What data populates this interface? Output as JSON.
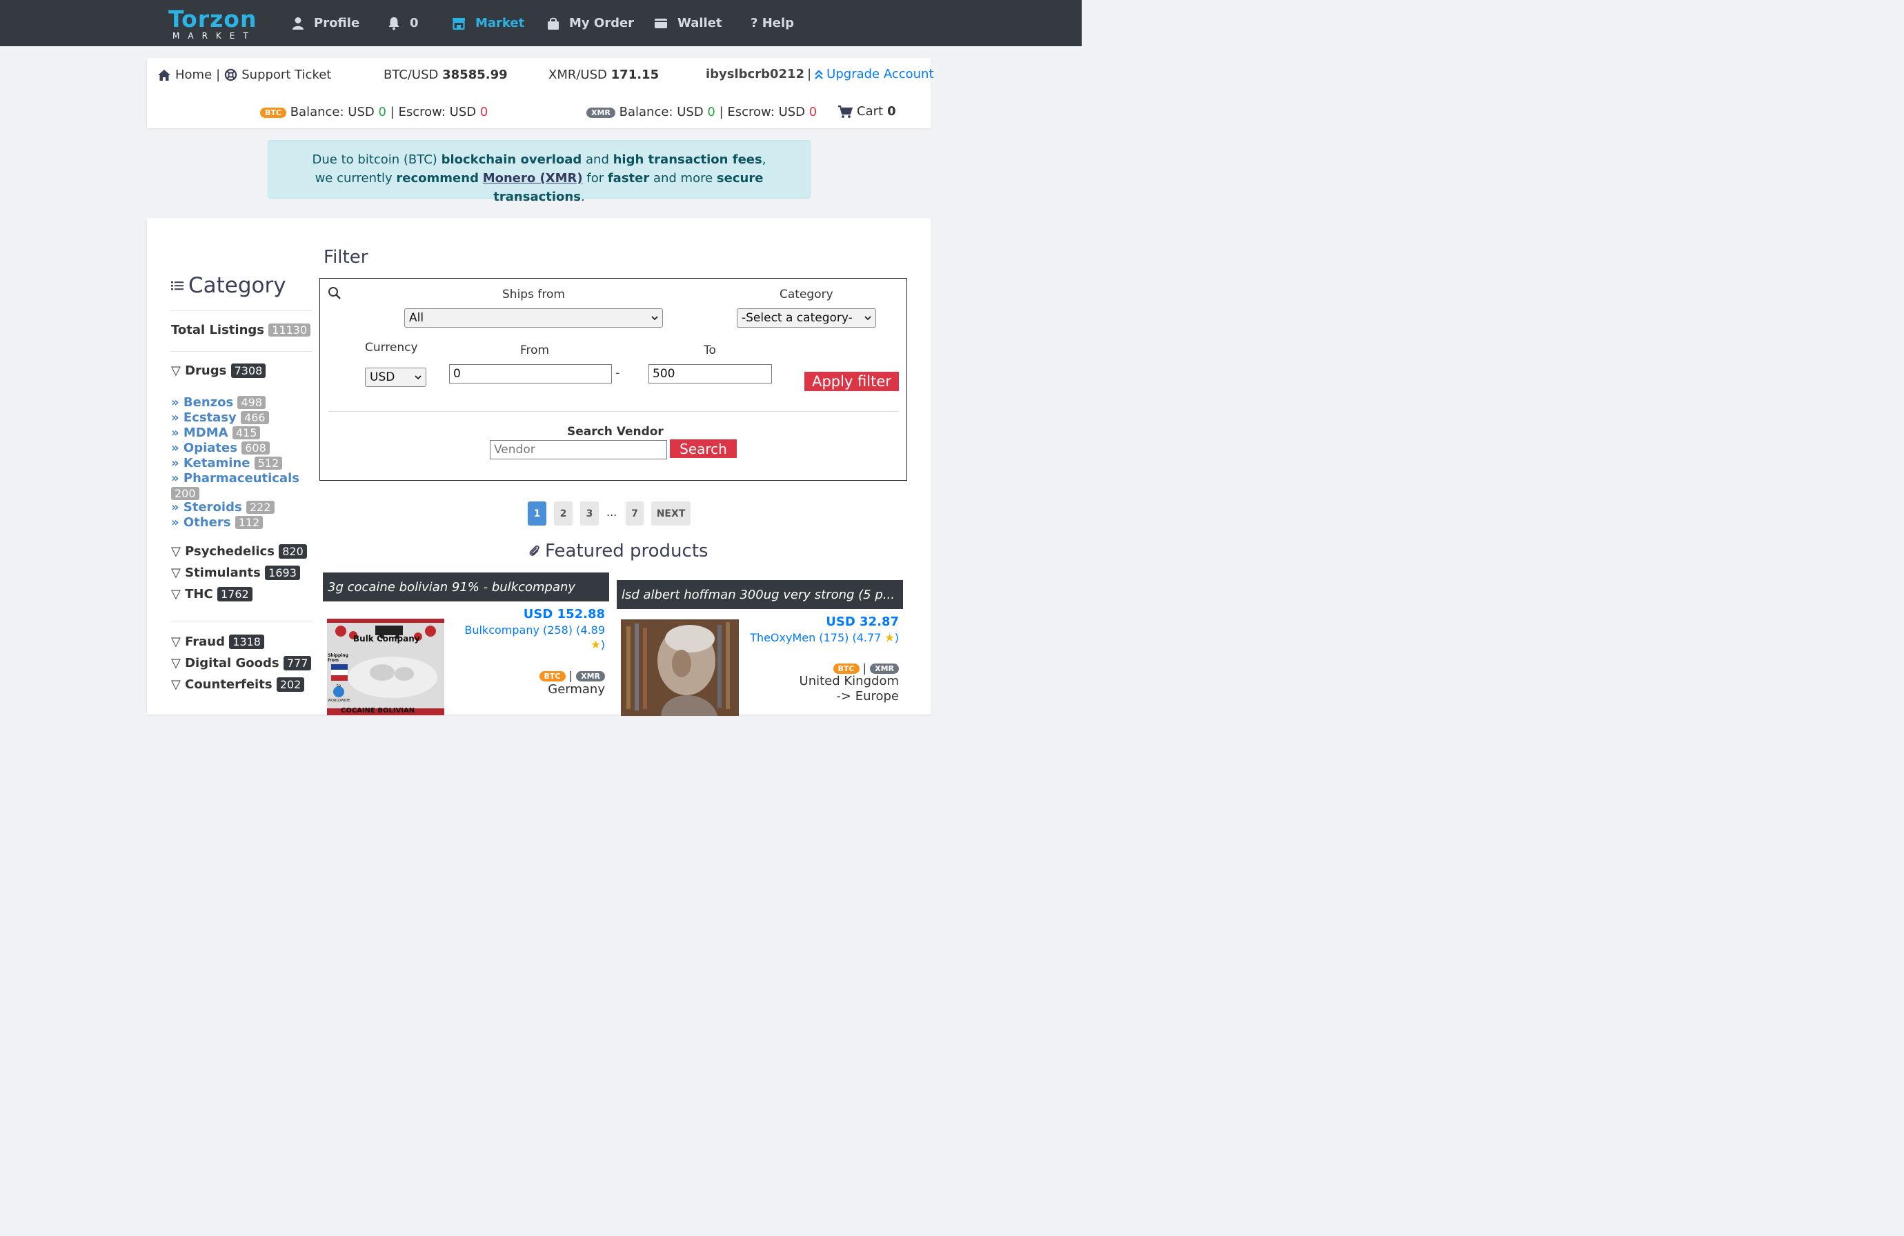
{
  "nav": {
    "logo": "Torzon",
    "logo_sub": "MARKET",
    "profile": "Profile",
    "notifications": "0",
    "market": "Market",
    "my_order": "My Order",
    "wallet": "Wallet",
    "help": "? Help"
  },
  "info": {
    "home": "Home",
    "sep1": "|",
    "support": "Support Ticket",
    "btc_label": "BTC/USD",
    "btc_value": "38585.99",
    "xmr_label": "XMR/USD",
    "xmr_value": "171.15",
    "username": "ibyslbcrb0212",
    "sep2": "|",
    "upgrade": "Upgrade Account",
    "btc_badge": "BTC",
    "xmr_badge": "XMR",
    "balance_label": "Balance: USD",
    "balance_value": "0",
    "escrow_label": "| Escrow: USD",
    "escrow_value": "0",
    "xmr_balance_value": "0",
    "xmr_escrow_value": "0",
    "cart_label": "Cart",
    "cart_count": "0"
  },
  "alert": {
    "l1_a": "Due to bitcoin (BTC)",
    "l1_b": "blockchain overload",
    "l1_c": "and",
    "l1_d": "high transaction fees",
    "l1_e": ",",
    "l2_a": "we currently",
    "l2_b": "recommend",
    "l2_c": "Monero (XMR)",
    "l2_d": "for",
    "l2_e": "faster",
    "l2_f": "and more",
    "l2_g": "secure transactions",
    "l2_h": "."
  },
  "sidebar": {
    "title": "Category",
    "total_label": "Total Listings",
    "total_count": "11130",
    "drugs_label": "▽ Drugs",
    "drugs_count": "7308",
    "subs": [
      {
        "label": "» Benzos",
        "count": "498"
      },
      {
        "label": "» Ecstasy",
        "count": "466"
      },
      {
        "label": "» MDMA",
        "count": "415"
      },
      {
        "label": "» Opiates",
        "count": "608"
      },
      {
        "label": "» Ketamine",
        "count": "512"
      },
      {
        "label": "» Pharmaceuticals",
        "count": "200"
      },
      {
        "label": "» Steroids",
        "count": "222"
      },
      {
        "label": "» Others",
        "count": "112"
      }
    ],
    "groups": [
      {
        "label": "▽ Psychedelics",
        "count": "820"
      },
      {
        "label": "▽ Stimulants",
        "count": "1693"
      },
      {
        "label": "▽ THC",
        "count": "1762"
      },
      {
        "label": "▽ Fraud",
        "count": "1318"
      },
      {
        "label": "▽ Digital Goods",
        "count": "777"
      },
      {
        "label": "▽ Counterfeits",
        "count": "202"
      }
    ]
  },
  "filter": {
    "title": "Filter",
    "ships_from_label": "Ships from",
    "ships_from_value": "All",
    "category_label": "Category",
    "category_value": "-Select a category-",
    "currency_label": "Currency",
    "currency_value": "USD",
    "from_label": "From",
    "from_value": "0",
    "range_sep": "-",
    "to_label": "To",
    "to_value": "500",
    "apply": "Apply filter",
    "vendor_label": "Search Vendor",
    "vendor_placeholder": "Vendor",
    "search": "Search"
  },
  "pagination": {
    "pages": [
      "1",
      "2",
      "3",
      "7"
    ],
    "ellipsis": "...",
    "next": "NEXT"
  },
  "featured": {
    "title": "Featured products",
    "products": [
      {
        "title": "3g cocaine bolivian 91% - bulkcompany",
        "price": "USD 152.88",
        "vendor": "Bulkcompany (258) (4.89",
        "vendor_end": ")",
        "cur_btc": "BTC",
        "cur_sep": "|",
        "cur_xmr": "XMR",
        "location": "Germany",
        "img_brand": "Bulk Company",
        "img_ship": "Shipping from",
        "img_to": "to",
        "img_dest": "WORLDWIDE",
        "img_bottom": "COCAINE BOLIVIAN"
      },
      {
        "title": "lsd albert hoffman 300ug very strong (5 p...",
        "price": "USD 32.87",
        "vendor": "TheOxyMen (175) (4.77",
        "vendor_end": ")",
        "cur_btc": "BTC",
        "cur_sep": "|",
        "cur_xmr": "XMR",
        "location": "United Kingdom",
        "location2": "-> Europe"
      }
    ]
  },
  "colors": {
    "nav_bg": "#343a40",
    "accent": "#2bb3e6",
    "link": "#007bff",
    "danger": "#dc3545",
    "success": "#28a745"
  }
}
